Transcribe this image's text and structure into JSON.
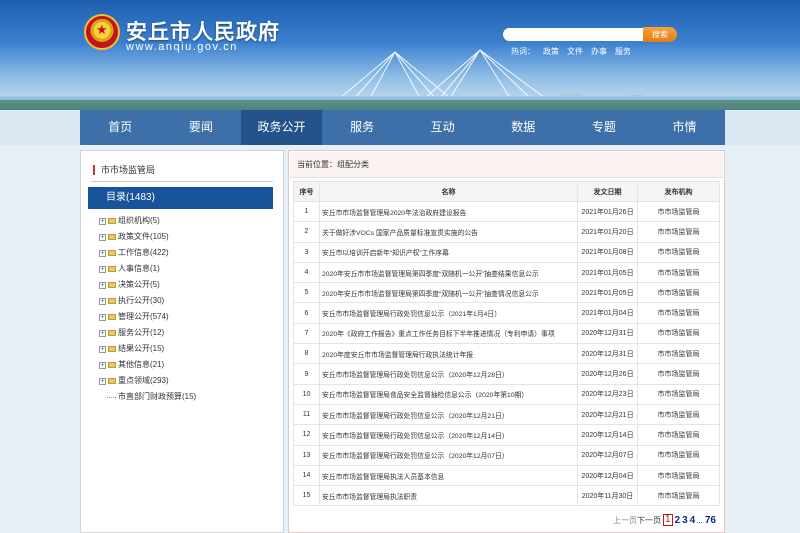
{
  "site": {
    "title": "安丘市人民政府",
    "url": "www.anqiu.gov.cn"
  },
  "search": {
    "button": "搜索",
    "hot_label": "热词：",
    "hot_words": [
      "政策",
      "文件",
      "办事",
      "服务"
    ]
  },
  "nav": [
    "首页",
    "要闻",
    "政务公开",
    "服务",
    "互动",
    "数据",
    "专题",
    "市情"
  ],
  "sidebar": {
    "title": "市市场监管局",
    "catalog": "目录(1483)",
    "items": [
      "组织机构(5)",
      "政策文件(105)",
      "工作信息(422)",
      "人事信息(1)",
      "决策公开(5)",
      "执行公开(30)",
      "管理公开(574)",
      "服务公开(12)",
      "结果公开(15)",
      "其他信息(21)",
      "重点领域(293)",
      "市直部门财政预算(15)"
    ]
  },
  "breadcrumb": "当前位置：组配分类",
  "table": {
    "headers": [
      "序号",
      "名称",
      "发文日期",
      "发布机构"
    ],
    "rows": [
      [
        "1",
        "安丘市市场监督管理局2020年法治政府建设报告",
        "2021年01月26日",
        "市市场监管局"
      ],
      [
        "2",
        "关于做好涉VOCs 国家产品质量标准宣贯实施的公告",
        "2021年01月20日",
        "市市场监管局"
      ],
      [
        "3",
        "安丘市以培训开启新年“知识产权”工作序幕",
        "2021年01月08日",
        "市市场监管局"
      ],
      [
        "4",
        "2020年安丘市市场监督管理局第四季度“双随机一公开”抽查结果信息公示",
        "2021年01月05日",
        "市市场监管局"
      ],
      [
        "5",
        "2020年安丘市市场监督管理局第四季度“双随机一公开”抽查情况信息公示",
        "2021年01月05日",
        "市市场监管局"
      ],
      [
        "6",
        "安丘市市场监督管理局行政处罚信息公示（2021年1月4日）",
        "2021年01月04日",
        "市市场监管局"
      ],
      [
        "7",
        "2020年《政府工作报告》重点工作任务目标下半年推进情况（专利申请）事项",
        "2020年12月31日",
        "市市场监管局"
      ],
      [
        "8",
        "2020年度安丘市市场监督管理局行政执法统计年报",
        "2020年12月31日",
        "市市场监管局"
      ],
      [
        "9",
        "安丘市市场监督管理局行政处罚信息公示（2020年12月28日）",
        "2020年12月26日",
        "市市场监管局"
      ],
      [
        "10",
        "安丘市市场监督管理局食品安全监督抽检信息公示（2020年第10期）",
        "2020年12月23日",
        "市市场监管局"
      ],
      [
        "11",
        "安丘市市场监督管理局行政处罚信息公示（2020年12月21日）",
        "2020年12月21日",
        "市市场监管局"
      ],
      [
        "12",
        "安丘市市场监督管理局行政处罚信息公示（2020年12月14日）",
        "2020年12月14日",
        "市市场监管局"
      ],
      [
        "13",
        "安丘市市场监督管理局行政处罚信息公示（2020年12月07日）",
        "2020年12月07日",
        "市市场监管局"
      ],
      [
        "14",
        "安丘市市场监督管理局执法人员基本信息",
        "2020年12月04日",
        "市市场监管局"
      ],
      [
        "15",
        "安丘市市场监督管理局执法职责",
        "2020年11月30日",
        "市市场监管局"
      ]
    ]
  },
  "pager": {
    "prev": "上一页",
    "next": "下一页",
    "current": "1",
    "pages": [
      "2",
      "3",
      "4"
    ],
    "ellipsis": "...",
    "last": "76"
  },
  "colors": {
    "nav_bg": "#3d6fa8",
    "nav_active": "#24538c",
    "catalog_bg": "#18549b",
    "search_btn": "#e98a1c"
  }
}
